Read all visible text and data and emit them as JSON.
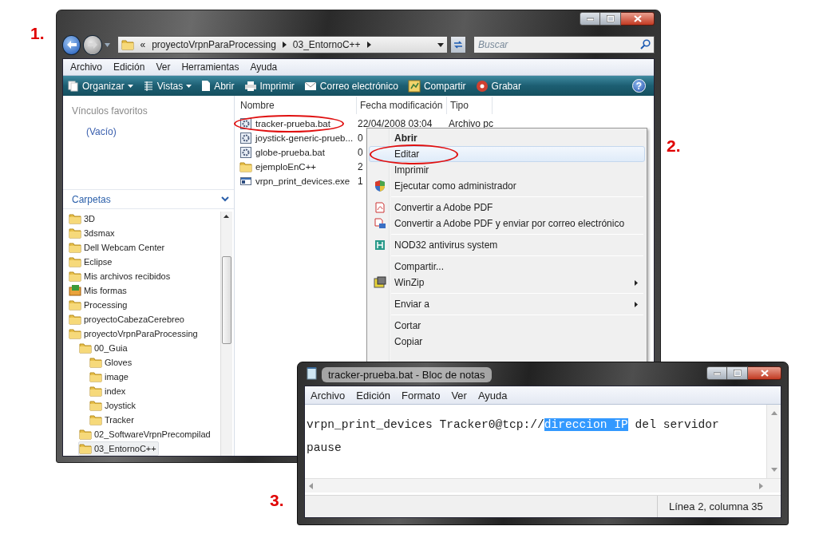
{
  "step_labels": [
    {
      "text": "1."
    },
    {
      "text": "2."
    },
    {
      "text": "3."
    }
  ],
  "explorer": {
    "breadcrumb": [
      "«",
      "proyectoVrpnParaProcessing",
      "03_EntornoC++"
    ],
    "search": {
      "placeholder": "Buscar"
    },
    "menu": [
      "Archivo",
      "Edición",
      "Ver",
      "Herramientas",
      "Ayuda"
    ],
    "toolbar": [
      {
        "label": "Organizar",
        "dropdown": true
      },
      {
        "label": "Vistas",
        "dropdown": true
      },
      {
        "label": "Abrir",
        "dropdown": false
      },
      {
        "label": "Imprimir",
        "dropdown": false
      },
      {
        "label": "Correo electrónico",
        "dropdown": false
      },
      {
        "label": "Compartir",
        "dropdown": false
      },
      {
        "label": "Grabar",
        "dropdown": false
      }
    ],
    "help_button": "?",
    "favorites": {
      "title": "Vínculos favoritos",
      "items": [
        "(Vacío)"
      ]
    },
    "folders": {
      "title": "Carpetas",
      "tree": [
        {
          "label": "3D",
          "kind": "folder",
          "selected": false
        },
        {
          "label": "3dsmax",
          "kind": "folder",
          "selected": false
        },
        {
          "label": "Dell Webcam Center",
          "kind": "folder",
          "selected": false
        },
        {
          "label": "Eclipse",
          "kind": "folder",
          "selected": false
        },
        {
          "label": "Mis archivos recibidos",
          "kind": "folder",
          "selected": false
        },
        {
          "label": "Mis formas",
          "kind": "forms",
          "selected": false
        },
        {
          "label": "Processing",
          "kind": "folder",
          "selected": false
        },
        {
          "label": "proyectoCabezaCerebreo",
          "kind": "folder",
          "selected": false
        },
        {
          "label": "proyectoVrpnParaProcessing",
          "kind": "folder",
          "selected": false,
          "children": [
            {
              "label": "00_Guia",
              "kind": "folder",
              "selected": false,
              "children": [
                {
                  "label": "Gloves",
                  "kind": "folder",
                  "selected": false
                },
                {
                  "label": "image",
                  "kind": "folder",
                  "selected": false
                },
                {
                  "label": "index",
                  "kind": "folder",
                  "selected": false
                },
                {
                  "label": "Joystick",
                  "kind": "folder",
                  "selected": false
                },
                {
                  "label": "Tracker",
                  "kind": "folder",
                  "selected": false
                }
              ]
            },
            {
              "label": "02_SoftwareVrpnPrecompilad",
              "kind": "folder",
              "selected": false
            },
            {
              "label": "03_EntornoC++",
              "kind": "folder",
              "selected": true
            }
          ]
        }
      ]
    },
    "columns": [
      "Nombre",
      "Fecha modificación",
      "Tipo"
    ],
    "files": [
      {
        "name": "tracker-prueba.bat",
        "kind": "batch",
        "modified": "22/04/2008 03:04",
        "type": "Archivo pc",
        "circled": true
      },
      {
        "name": "joystick-generic-prueb...",
        "kind": "batch",
        "modified": "0",
        "circled": false
      },
      {
        "name": "globe-prueba.bat",
        "kind": "batch",
        "modified": "0",
        "circled": false
      },
      {
        "name": "ejemploEnC++",
        "kind": "folder",
        "modified": "2",
        "circled": false
      },
      {
        "name": "vrpn_print_devices.exe",
        "kind": "program",
        "modified": "1",
        "circled": false
      }
    ]
  },
  "context_menu": {
    "groups": [
      [
        {
          "label": "Abrir",
          "kind": "plain",
          "bold": true,
          "highlighted": false,
          "circled": false
        },
        {
          "label": "Editar",
          "kind": "plain",
          "bold": false,
          "highlighted": true,
          "circled": true
        },
        {
          "label": "Imprimir",
          "kind": "plain",
          "bold": false,
          "highlighted": false,
          "circled": false
        },
        {
          "label": "Ejecutar como administrador",
          "kind": "shield",
          "bold": false,
          "highlighted": false,
          "circled": false
        }
      ],
      [
        {
          "label": "Convertir a Adobe PDF",
          "kind": "pdf",
          "bold": false,
          "highlighted": false,
          "circled": false
        },
        {
          "label": "Convertir a Adobe PDF y enviar por correo electrónico",
          "kind": "pdfmail",
          "bold": false,
          "highlighted": false,
          "circled": false
        }
      ],
      [
        {
          "label": "NOD32 antivirus system",
          "kind": "antivirus",
          "bold": false,
          "highlighted": false,
          "circled": false
        }
      ],
      [
        {
          "label": "Compartir...",
          "kind": "plain",
          "bold": false,
          "highlighted": false,
          "circled": false
        },
        {
          "label": "WinZip",
          "kind": "zip",
          "submenu": true,
          "bold": false,
          "highlighted": false,
          "circled": false
        }
      ],
      [
        {
          "label": "Enviar a",
          "kind": "plain",
          "submenu": true,
          "bold": false,
          "highlighted": false,
          "circled": false
        }
      ],
      [
        {
          "label": "Cortar",
          "kind": "plain",
          "bold": false,
          "highlighted": false,
          "circled": false
        },
        {
          "label": "Copiar",
          "kind": "plain",
          "bold": false,
          "highlighted": false,
          "circled": false
        }
      ]
    ]
  },
  "notepad": {
    "title": "tracker-prueba.bat - Bloc de notas",
    "menu": [
      "Archivo",
      "Edición",
      "Formato",
      "Ver",
      "Ayuda"
    ],
    "lines": [
      [
        {
          "text": "vrpn_print_devices Tracker0@tcp://",
          "selected": false
        },
        {
          "text": "direccion IP",
          "selected": true
        },
        {
          "text": " del servidor",
          "selected": false
        }
      ],
      [
        {
          "text": "pause",
          "selected": false
        }
      ]
    ],
    "status": "Línea 2, columna 35"
  }
}
